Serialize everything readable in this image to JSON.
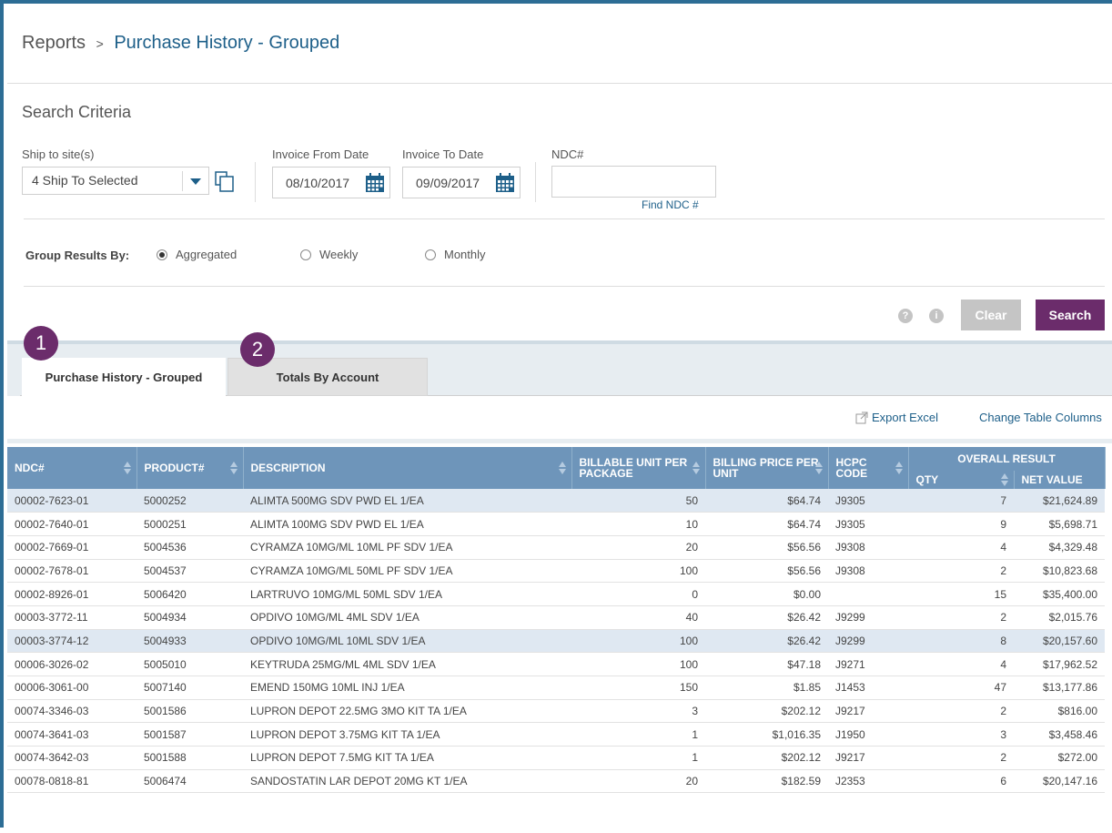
{
  "breadcrumb": {
    "root": "Reports",
    "separator": ">",
    "current": "Purchase History - Grouped"
  },
  "search": {
    "title": "Search Criteria",
    "ship_label": "Ship to site(s)",
    "ship_value": "4 Ship To Selected",
    "from_label": "Invoice From Date",
    "from_value": "08/10/2017",
    "to_label": "Invoice To Date",
    "to_value": "09/09/2017",
    "ndc_label": "NDC#",
    "ndc_value": "",
    "find_ndc": "Find NDC #",
    "group_label": "Group Results By:",
    "group_options": [
      "Aggregated",
      "Weekly",
      "Monthly"
    ],
    "group_selected": "Aggregated",
    "clear_label": "Clear",
    "search_label": "Search"
  },
  "tabs": [
    {
      "label": "Purchase History - Grouped",
      "badge": "1",
      "active": true
    },
    {
      "label": "Totals By Account",
      "badge": "2",
      "active": false
    }
  ],
  "toolbar": {
    "export_label": "Export Excel",
    "columns_label": "Change Table Columns"
  },
  "table": {
    "headers": {
      "ndc": "NDC#",
      "product": "PRODUCT#",
      "description": "DESCRIPTION",
      "billable": "BILLABLE UNIT PER PACKAGE",
      "price": "BILLING PRICE PER UNIT",
      "hcpc": "HCPC CODE",
      "overall": "OVERALL RESULT",
      "qty": "QTY",
      "net": "NET VALUE"
    },
    "rows": [
      {
        "ndc": "00002-7623-01",
        "product": "5000252",
        "desc": "ALIMTA 500MG SDV PWD EL 1/EA",
        "unit": "50",
        "price": "$64.74",
        "hcpc": "J9305",
        "qty": "7",
        "net": "$21,624.89",
        "hl": true
      },
      {
        "ndc": "00002-7640-01",
        "product": "5000251",
        "desc": "ALIMTA 100MG SDV PWD EL 1/EA",
        "unit": "10",
        "price": "$64.74",
        "hcpc": "J9305",
        "qty": "9",
        "net": "$5,698.71",
        "hl": false
      },
      {
        "ndc": "00002-7669-01",
        "product": "5004536",
        "desc": "CYRAMZA 10MG/ML 10ML PF SDV 1/EA",
        "unit": "20",
        "price": "$56.56",
        "hcpc": "J9308",
        "qty": "4",
        "net": "$4,329.48",
        "hl": false
      },
      {
        "ndc": "00002-7678-01",
        "product": "5004537",
        "desc": "CYRAMZA 10MG/ML 50ML PF SDV 1/EA",
        "unit": "100",
        "price": "$56.56",
        "hcpc": "J9308",
        "qty": "2",
        "net": "$10,823.68",
        "hl": false
      },
      {
        "ndc": "00002-8926-01",
        "product": "5006420",
        "desc": "LARTRUVO 10MG/ML 50ML SDV 1/EA",
        "unit": "0",
        "price": "$0.00",
        "hcpc": "",
        "qty": "15",
        "net": "$35,400.00",
        "hl": false
      },
      {
        "ndc": "00003-3772-11",
        "product": "5004934",
        "desc": "OPDIVO 10MG/ML 4ML SDV 1/EA",
        "unit": "40",
        "price": "$26.42",
        "hcpc": "J9299",
        "qty": "2",
        "net": "$2,015.76",
        "hl": false
      },
      {
        "ndc": "00003-3774-12",
        "product": "5004933",
        "desc": "OPDIVO 10MG/ML 10ML SDV 1/EA",
        "unit": "100",
        "price": "$26.42",
        "hcpc": "J9299",
        "qty": "8",
        "net": "$20,157.60",
        "hl": true
      },
      {
        "ndc": "00006-3026-02",
        "product": "5005010",
        "desc": "KEYTRUDA 25MG/ML 4ML SDV 1/EA",
        "unit": "100",
        "price": "$47.18",
        "hcpc": "J9271",
        "qty": "4",
        "net": "$17,962.52",
        "hl": false
      },
      {
        "ndc": "00006-3061-00",
        "product": "5007140",
        "desc": "EMEND 150MG 10ML INJ 1/EA",
        "unit": "150",
        "price": "$1.85",
        "hcpc": "J1453",
        "qty": "47",
        "net": "$13,177.86",
        "hl": false
      },
      {
        "ndc": "00074-3346-03",
        "product": "5001586",
        "desc": "LUPRON DEPOT 22.5MG 3MO KIT TA 1/EA",
        "unit": "3",
        "price": "$202.12",
        "hcpc": "J9217",
        "qty": "2",
        "net": "$816.00",
        "hl": false
      },
      {
        "ndc": "00074-3641-03",
        "product": "5001587",
        "desc": "LUPRON DEPOT 3.75MG KIT TA 1/EA",
        "unit": "1",
        "price": "$1,016.35",
        "hcpc": "J1950",
        "qty": "3",
        "net": "$3,458.46",
        "hl": false
      },
      {
        "ndc": "00074-3642-03",
        "product": "5001588",
        "desc": "LUPRON DEPOT 7.5MG KIT TA 1/EA",
        "unit": "1",
        "price": "$202.12",
        "hcpc": "J9217",
        "qty": "2",
        "net": "$272.00",
        "hl": false
      },
      {
        "ndc": "00078-0818-81",
        "product": "5006474",
        "desc": "SANDOSTATIN LAR DEPOT 20MG KT 1/EA",
        "unit": "20",
        "price": "$182.59",
        "hcpc": "J2353",
        "qty": "6",
        "net": "$20,147.16",
        "hl": false
      }
    ]
  }
}
